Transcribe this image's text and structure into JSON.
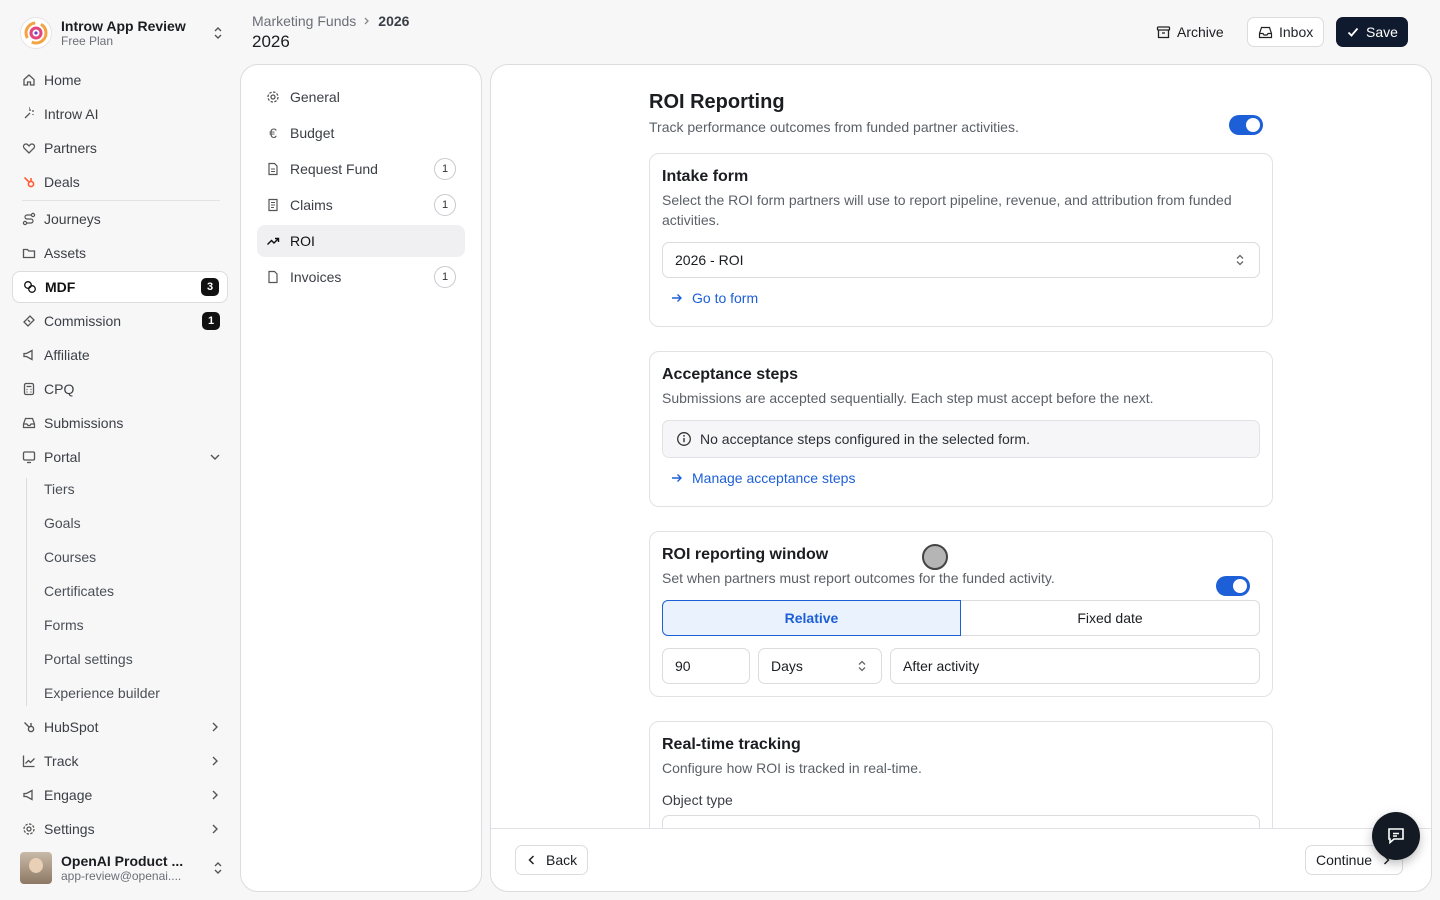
{
  "workspace": {
    "name": "Introw App Review",
    "plan": "Free Plan"
  },
  "sidebar": {
    "items": [
      {
        "label": "Home",
        "icon": "home-icon"
      },
      {
        "label": "Introw AI",
        "icon": "sparkle-icon"
      },
      {
        "label": "Partners",
        "icon": "handshake-icon"
      },
      {
        "label": "Deals",
        "icon": "hubspot-icon"
      },
      {
        "label": "Journeys",
        "icon": "route-icon"
      },
      {
        "label": "Assets",
        "icon": "folder-icon"
      },
      {
        "label": "MDF",
        "icon": "coins-icon",
        "badge": "3"
      },
      {
        "label": "Commission",
        "icon": "ticket-icon",
        "badge": "1"
      },
      {
        "label": "Affiliate",
        "icon": "megaphone-icon"
      },
      {
        "label": "CPQ",
        "icon": "calculator-icon"
      },
      {
        "label": "Submissions",
        "icon": "inbox-icon"
      },
      {
        "label": "Portal",
        "icon": "monitor-icon"
      },
      {
        "label": "HubSpot",
        "icon": "hubspot-icon"
      },
      {
        "label": "Track",
        "icon": "chart-icon"
      },
      {
        "label": "Engage",
        "icon": "megaphone-icon"
      },
      {
        "label": "Settings",
        "icon": "gear-icon"
      }
    ],
    "portal_sub": [
      "Tiers",
      "Goals",
      "Courses",
      "Certificates",
      "Forms",
      "Portal settings",
      "Experience builder"
    ]
  },
  "user": {
    "name": "OpenAI Product ...",
    "email": "app-review@openai...."
  },
  "header": {
    "breadcrumb_parent": "Marketing Funds",
    "breadcrumb_current": "2026",
    "title": "2026",
    "archive_label": "Archive",
    "inbox_label": "Inbox",
    "save_label": "Save"
  },
  "sections": [
    {
      "label": "General",
      "icon": "gear-icon"
    },
    {
      "label": "Budget",
      "icon": "euro-icon"
    },
    {
      "label": "Request Fund",
      "icon": "document-icon",
      "count": "1"
    },
    {
      "label": "Claims",
      "icon": "receipt-icon",
      "count": "1"
    },
    {
      "label": "ROI",
      "icon": "trend-up-icon"
    },
    {
      "label": "Invoices",
      "icon": "file-icon",
      "count": "1"
    }
  ],
  "roi": {
    "title": "ROI Reporting",
    "subtitle": "Track performance outcomes from funded partner activities.",
    "enabled": true,
    "intake": {
      "title": "Intake form",
      "desc": "Select the ROI form partners will use to report pipeline, revenue, and attribution from funded activities.",
      "selected_form": "2026 - ROI",
      "link": "Go to form"
    },
    "acceptance": {
      "title": "Acceptance steps",
      "desc": "Submissions are accepted sequentially. Each step must accept before the next.",
      "info": "No acceptance steps configured in the selected form.",
      "link": "Manage acceptance steps"
    },
    "window": {
      "title": "ROI reporting window",
      "desc": "Set when partners must report outcomes for the funded activity.",
      "enabled": true,
      "mode_relative": "Relative",
      "mode_fixed": "Fixed date",
      "amount": "90",
      "unit": "Days",
      "anchor": "After activity"
    },
    "realtime": {
      "title": "Real-time tracking",
      "desc": "Configure how ROI is tracked in real-time.",
      "object_type_label": "Object type"
    }
  },
  "footer": {
    "back_label": "Back",
    "continue_label": "Continue"
  },
  "colors": {
    "accent": "#1d5fd6",
    "save_bg": "#0f1a2e",
    "hubspot": "#ff5c35"
  }
}
